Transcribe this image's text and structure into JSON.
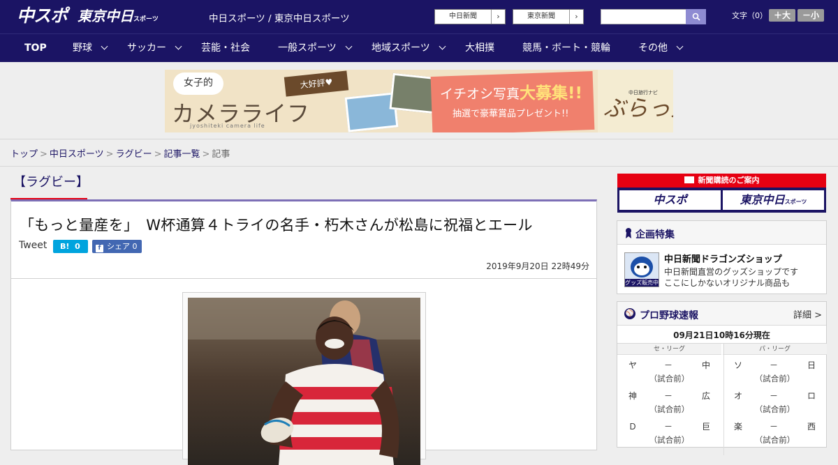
{
  "header": {
    "logo_chuspo": "中スポ",
    "logo_tokyo": "東京中日",
    "logo_tokyo_sub": "スポーツ",
    "site_names": "中日スポーツ / 東京中日スポーツ",
    "paper_links": [
      {
        "label": "中日新聞"
      },
      {
        "label": "東京新聞"
      }
    ],
    "search": {
      "placeholder": "",
      "icon": "search-icon"
    },
    "font_size_label": "文字（0）",
    "font_larger": "＋大",
    "font_smaller": "－小"
  },
  "nav": {
    "items": [
      {
        "label": "TOP",
        "dropdown": false
      },
      {
        "label": "野球",
        "dropdown": true
      },
      {
        "label": "サッカー",
        "dropdown": true
      },
      {
        "label": "芸能・社会",
        "dropdown": false
      },
      {
        "label": "一般スポーツ",
        "dropdown": true
      },
      {
        "label": "地域スポーツ",
        "dropdown": true
      },
      {
        "label": "大相撲",
        "dropdown": false
      },
      {
        "label": "競馬・ボート・競輪",
        "dropdown": false
      },
      {
        "label": "その他",
        "dropdown": true
      }
    ]
  },
  "banner": {
    "joshi": "女子的",
    "camera_life": "カメラライフ",
    "sub": "jyoshiteki camera life",
    "ribbon": "大好評♥",
    "headline_a": "イチオシ写真",
    "headline_b": "大募集!!",
    "present": "抽選で豪華賞品プレゼント!!",
    "navi": "中日旅行ナビ",
    "brand": "ぶらっ人"
  },
  "breadcrumb": {
    "items": [
      "トップ",
      "中日スポーツ",
      "ラグビー",
      "記事一覧"
    ],
    "current": "記事"
  },
  "article": {
    "category": "【ラグビー】",
    "headline": "「もっと量産を」　W杯通算４トライの名手・朽木さんが松島に祝福とエール",
    "tweet": "Tweet",
    "hatena_count": "0",
    "fb_label": "シェア",
    "fb_count": "0",
    "date": "2019年9月20日 22時49分"
  },
  "sidebar": {
    "subscribe": {
      "title": "新聞購読のご案内",
      "chuspo": "中スポ",
      "tokyo": "東京中日",
      "tokyo_sub": "スポーツ"
    },
    "special": {
      "title": "企画特集",
      "shop_label": "グッズ販売中",
      "shop_title": "中日新聞ドラゴンズショップ",
      "desc1": "中日新聞直営のグッズショップです",
      "desc2": "ここにしかないオリジナル商品も"
    },
    "baseball": {
      "title": "プロ野球速報",
      "more": "詳細 >",
      "time": "09月21日10時16分現在",
      "central": "セ・リーグ",
      "pacific": "パ・リーグ",
      "central_games": [
        {
          "home": "ヤ",
          "dash": "－",
          "away": "中",
          "status": "（試合前）"
        },
        {
          "home": "神",
          "dash": "－",
          "away": "広",
          "status": "（試合前）"
        },
        {
          "home": "Ｄ",
          "dash": "－",
          "away": "巨",
          "status": "（試合前）"
        }
      ],
      "pacific_games": [
        {
          "home": "ソ",
          "dash": "－",
          "away": "日",
          "status": "（試合前）"
        },
        {
          "home": "オ",
          "dash": "－",
          "away": "ロ",
          "status": "（試合前）"
        },
        {
          "home": "楽",
          "dash": "－",
          "away": "西",
          "status": "（試合前）"
        }
      ]
    }
  },
  "colors": {
    "brand_navy": "#1b1464",
    "accent_red": "#e60012",
    "article_top_border": "#7d6fb6",
    "hatena_blue": "#00a4de",
    "facebook_blue": "#4267b2"
  }
}
